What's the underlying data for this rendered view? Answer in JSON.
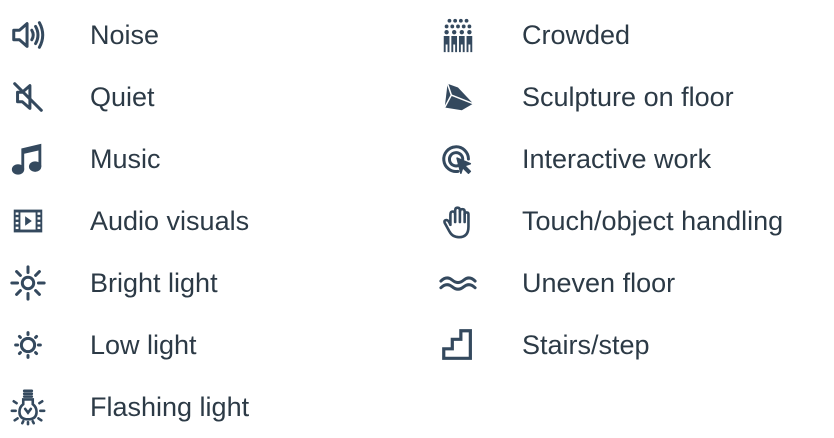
{
  "colors": {
    "icon": "#34495e",
    "text": "#2c3a46",
    "background": "#ffffff"
  },
  "left_items": [
    {
      "icon": "speaker-loud-icon",
      "label": "Noise"
    },
    {
      "icon": "speaker-muted-icon",
      "label": "Quiet"
    },
    {
      "icon": "music-note-icon",
      "label": "Music"
    },
    {
      "icon": "film-play-icon",
      "label": "Audio visuals"
    },
    {
      "icon": "sun-bright-icon",
      "label": "Bright light"
    },
    {
      "icon": "sun-low-icon",
      "label": "Low light"
    },
    {
      "icon": "flashing-bulb-icon",
      "label": "Flashing light"
    }
  ],
  "right_items": [
    {
      "icon": "crowd-icon",
      "label": "Crowded"
    },
    {
      "icon": "sculpture-icon",
      "label": "Sculpture on floor"
    },
    {
      "icon": "cursor-click-icon",
      "label": "Interactive work"
    },
    {
      "icon": "hand-icon",
      "label": "Touch/object handling"
    },
    {
      "icon": "waves-icon",
      "label": "Uneven floor"
    },
    {
      "icon": "stairs-icon",
      "label": "Stairs/step"
    }
  ]
}
